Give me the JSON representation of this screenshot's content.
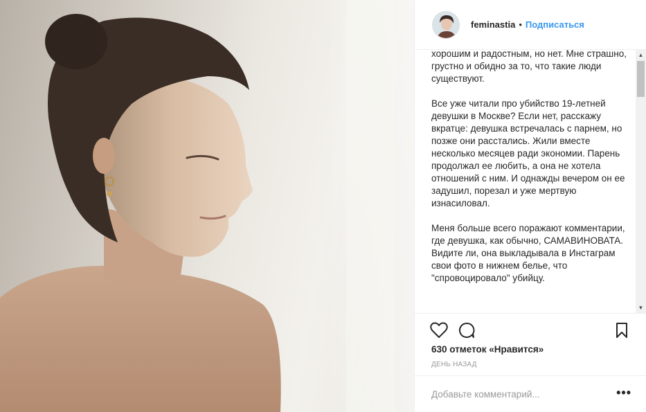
{
  "post": {
    "username": "feminastia",
    "separator": "•",
    "follow_label": "Подписаться",
    "caption": {
      "p1": "хорошим и радостным, но нет. Мне страшно, грустно и обидно за то, что такие люди существуют.",
      "p2": "Все уже читали про убийство 19-летней девушки в Москве? Если нет, расскажу вкратце: девушка встречалась с парнем, но позже они расстались. Жили вместе несколько месяцев ради экономии. Парень продолжал ее любить, а она не хотела отношений с ним. И однажды вечером он ее задушил, порезал и уже мертвую изнасиловал.",
      "p3": "Меня больше всего поражают комментарии, где девушка, как обычно, САМАВИНОВАТА. Видите ли, она выкладывала в Инстаграм свои фото в нижнем белье, что \"спровоцировало\" убийцу."
    },
    "likes_text": "630 отметок «Нравится»",
    "time_text": "день назад",
    "comment_placeholder": "Добавьте комментарий...",
    "more_label": "•••"
  },
  "icons": {
    "like": "heart-icon",
    "comment": "speech-bubble-icon",
    "save": "bookmark-icon",
    "more": "more-options-icon"
  },
  "colors": {
    "link_blue": "#3897f0",
    "text": "#262626",
    "muted": "#999999",
    "border": "#efefef"
  }
}
